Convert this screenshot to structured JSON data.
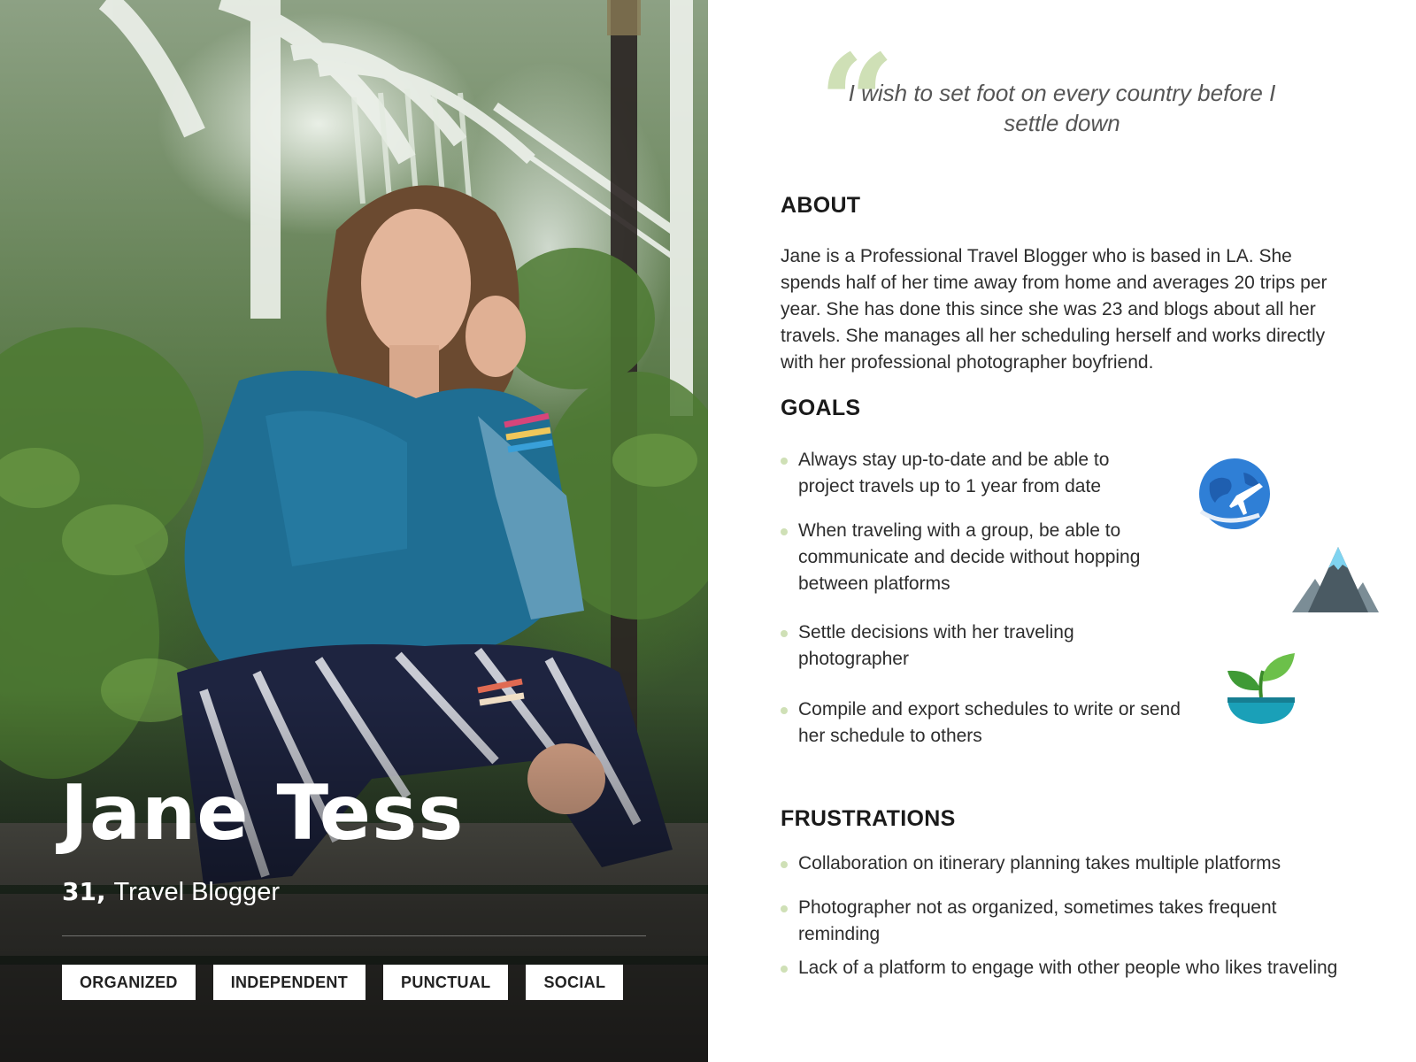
{
  "persona": {
    "name": "Jane Tess",
    "age": "31,",
    "role": "Travel Blogger",
    "traits": [
      "ORGANIZED",
      "INDEPENDENT",
      "PUNCTUAL",
      "SOCIAL"
    ]
  },
  "quote": {
    "mark": "“",
    "text": "I wish to set foot on every country before I settle down"
  },
  "about": {
    "heading": "ABOUT",
    "text": "Jane is a Professional Travel Blogger who is based in LA. She spends half of her time away from home and averages 20 trips per year. She has done this since she was 23 and blogs about all her travels. She manages all her scheduling herself and works directly with her professional photographer boyfriend."
  },
  "goals": {
    "heading": "GOALS",
    "items": [
      "Always stay up-to-date and be able to project travels up to 1 year from date",
      "When traveling with a group, be able to communicate and decide without hopping between platforms",
      "Settle decisions with her traveling photographer",
      "Compile and export schedules to write or send her schedule to others"
    ],
    "icons": [
      "globe-plane-icon",
      "mountain-icon",
      "plant-bowl-icon"
    ]
  },
  "frustrations": {
    "heading": "FRUSTRATIONS",
    "items": [
      "Collaboration on itinerary planning takes multiple platforms",
      "Photographer not as organized, sometimes takes frequent reminding",
      "Lack of a platform to engage with other people who likes traveling"
    ]
  },
  "colors": {
    "accent": "#cfe0b6",
    "heading": "#1a1a1a",
    "body": "#2d2d2d",
    "quote": "#555555"
  }
}
